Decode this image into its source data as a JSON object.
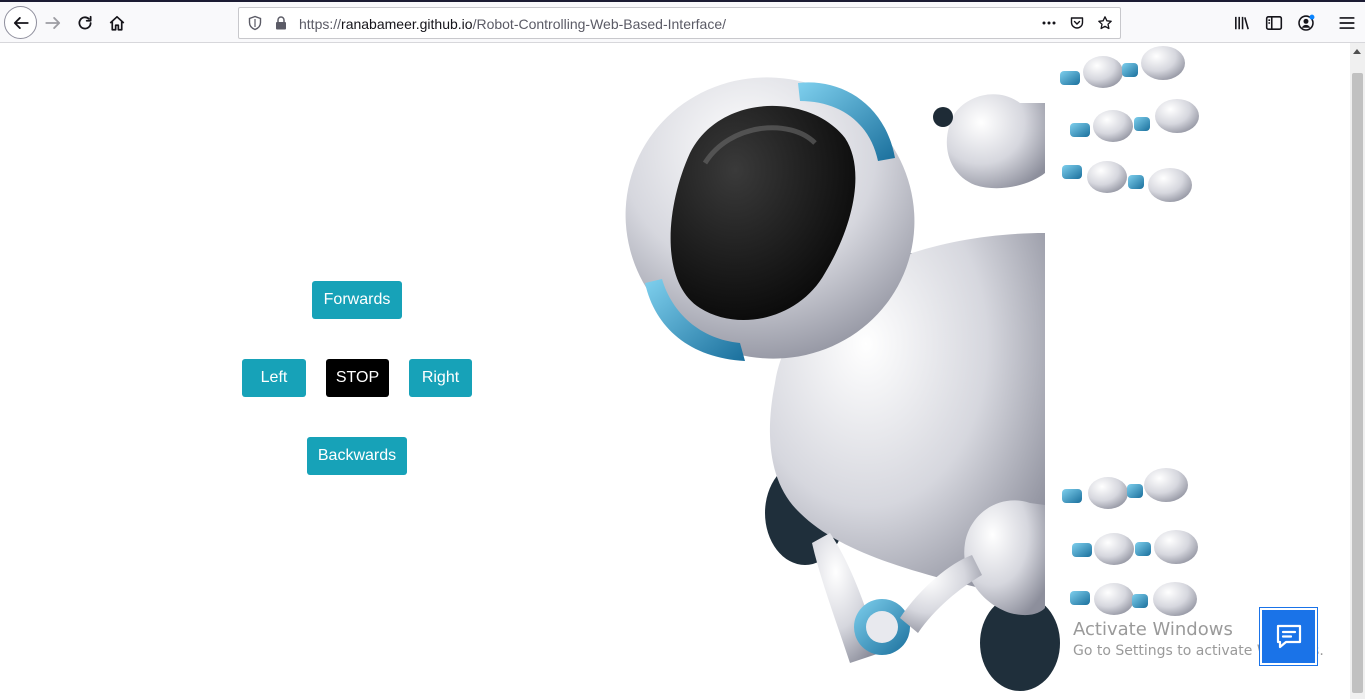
{
  "browser": {
    "url_prefix": "https://",
    "url_host": "ranabameer.github.io",
    "url_path": "/Robot-Controlling-Web-Based-Interface/",
    "icons": [
      "back-icon",
      "forward-icon",
      "reload-icon",
      "home-icon",
      "shield-icon",
      "lock-icon",
      "more-icon",
      "pocket-icon",
      "star-icon",
      "library-icon",
      "sidebar-icon",
      "account-icon",
      "menu-icon"
    ]
  },
  "controls": {
    "forwards": "Forwards",
    "left": "Left",
    "stop": "STOP",
    "right": "Right",
    "backwards": "Backwards"
  },
  "watermark": {
    "line1": "Activate Windows",
    "line2": "Go to Settings to activate Windows."
  },
  "colors": {
    "button": "#17a2b8",
    "stop": "#000000",
    "chat": "#1a73e8"
  }
}
